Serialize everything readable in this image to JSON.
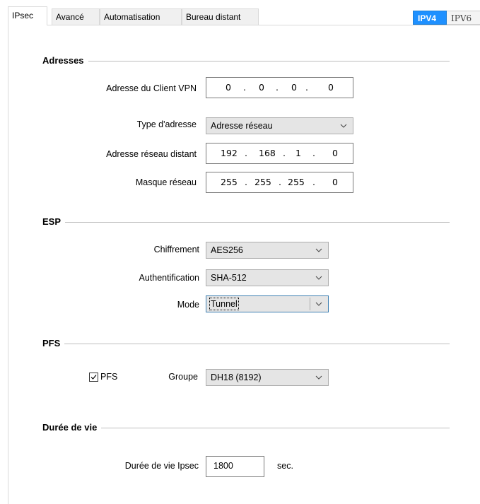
{
  "tabs": [
    {
      "label": "IPsec",
      "active": true
    },
    {
      "label": "Avancé",
      "active": false
    },
    {
      "label": "Automatisation",
      "active": false
    },
    {
      "label": "Bureau distant",
      "active": false
    }
  ],
  "ip_version": {
    "ipv4": "IPV4",
    "ipv6": "IPV6",
    "selected": "IPV4"
  },
  "colors": {
    "accent": "#1e90ff"
  },
  "addresses": {
    "section_title": "Adresses",
    "client_label": "Adresse du Client VPN",
    "client_ip": [
      "0",
      "0",
      "0",
      "0"
    ],
    "type_label": "Type d'adresse",
    "type_value": "Adresse réseau",
    "remote_label": "Adresse réseau distant",
    "remote_ip": [
      "192",
      "168",
      "1",
      "0"
    ],
    "mask_label": "Masque réseau",
    "mask_ip": [
      "255",
      "255",
      "255",
      "0"
    ]
  },
  "esp": {
    "section_title": "ESP",
    "cipher_label": "Chiffrement",
    "cipher_value": "AES256",
    "auth_label": "Authentification",
    "auth_value": "SHA-512",
    "mode_label": "Mode",
    "mode_value": "Tunnel"
  },
  "pfs": {
    "section_title": "PFS",
    "checkbox_label": "PFS",
    "checked": true,
    "group_label": "Groupe",
    "group_value": "DH18 (8192)"
  },
  "lifetime": {
    "section_title": "Durée de vie",
    "ipsec_label": "Durée de vie Ipsec",
    "ipsec_value": "1800",
    "unit": "sec."
  },
  "ip_separator": "."
}
